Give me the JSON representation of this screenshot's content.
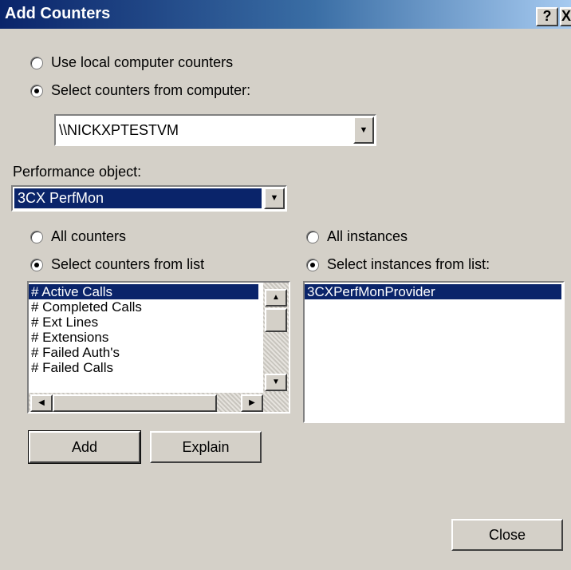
{
  "window": {
    "title": "Add Counters",
    "help_label": "?",
    "close_label": "X"
  },
  "source": {
    "local_label": "Use local computer counters",
    "remote_label": "Select counters from computer:",
    "computer_value": "\\\\NICKXPTESTVM"
  },
  "performance": {
    "label": "Performance object:",
    "value": "3CX PerfMon"
  },
  "counters": {
    "all_label": "All counters",
    "list_label": "Select counters from list",
    "items": [
      "# Active Calls",
      "# Completed Calls",
      "# Ext Lines",
      "# Extensions",
      "# Failed Auth's",
      "# Failed Calls"
    ]
  },
  "instances": {
    "all_label": "All instances",
    "list_label": "Select instances from list:",
    "items": [
      "3CXPerfMonProvider"
    ]
  },
  "buttons": {
    "add": "Add",
    "explain": "Explain",
    "close": "Close"
  },
  "icons": {
    "up": "scroll-up-icon",
    "down": "scroll-down-icon",
    "left": "scroll-left-icon",
    "right": "scroll-right-icon",
    "dropdown": "dropdown-arrow-icon"
  },
  "colors": {
    "titlebar_start": "#0a246a",
    "selection": "#0a246a",
    "face": "#d4d0c8"
  }
}
